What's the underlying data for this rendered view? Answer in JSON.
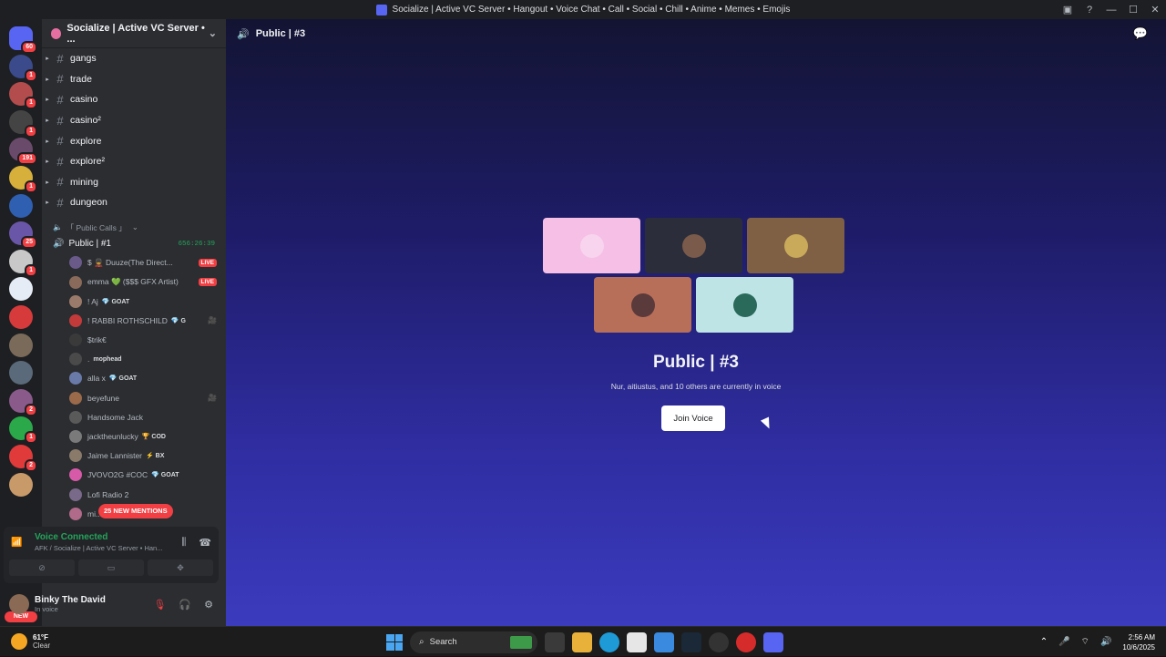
{
  "window": {
    "title": "Socialize | Active VC Server • Hangout • Voice Chat • Call • Social • Chill • Anime • Memes • Emojis"
  },
  "servers": [
    {
      "name": "discord-home",
      "color": "#5865f2",
      "badge": "60"
    },
    {
      "color": "#3a4a8a",
      "badge": "1"
    },
    {
      "color": "#b34d4d",
      "badge": "1"
    },
    {
      "color": "#444",
      "badge": "1"
    },
    {
      "color": "#6a4a6a",
      "badge": "191"
    },
    {
      "color": "#d6b03a",
      "badge": "1"
    },
    {
      "color": "#2f5fb0",
      "badge": ""
    },
    {
      "color": "#6a56a8",
      "badge": "25"
    },
    {
      "color": "#c8c8c8",
      "badge": "1"
    },
    {
      "color": "#e6ecf5",
      "badge": ""
    },
    {
      "color": "#d63a3a",
      "badge": ""
    },
    {
      "color": "#7a6a5a",
      "badge": ""
    },
    {
      "color": "#5a6a7a",
      "badge": ""
    },
    {
      "color": "#8a5a8a",
      "badge": "2"
    },
    {
      "color": "#2aa84a",
      "badge": "1"
    },
    {
      "color": "#e03a3a",
      "badge": "2"
    },
    {
      "color": "#c89a6a",
      "badge": ""
    }
  ],
  "new_pill": "NEW",
  "guild": {
    "name": "Socialize | Active VC Server • ..."
  },
  "channels": [
    {
      "name": "gangs"
    },
    {
      "name": "trade"
    },
    {
      "name": "casino"
    },
    {
      "name": "casino²"
    },
    {
      "name": "explore"
    },
    {
      "name": "explore²"
    },
    {
      "name": "mining"
    },
    {
      "name": "dungeon"
    }
  ],
  "category": "「 Public Calls 」",
  "voice_channel": {
    "name": "Public | #1",
    "timer": "656:26:39"
  },
  "members": [
    {
      "name": "$ 💂 Duuze(The Direct...",
      "tag": "",
      "live": "LIVE",
      "av": "#6a5a8a",
      "icon": ""
    },
    {
      "name": "emma 💚 ($$$ GFX Artist)",
      "tag": "",
      "live": "LIVE",
      "av": "#8a6a5a",
      "icon": ""
    },
    {
      "name": "! Aj",
      "tag": "💎 GOAT",
      "live": "",
      "av": "#9a7a6a",
      "icon": ""
    },
    {
      "name": "! RABBI ROTHSCHILD",
      "tag": "💎 G",
      "live": "",
      "av": "#c23a3a",
      "icon": "🎥"
    },
    {
      "name": "$trik€",
      "tag": "",
      "live": "",
      "av": "#3a3a3a",
      "icon": ""
    },
    {
      "name": ".",
      "tag": "mophead",
      "live": "",
      "av": "#4a4a4a",
      "icon": ""
    },
    {
      "name": "alla x",
      "tag": "💎 GOAT",
      "live": "",
      "av": "#6a7aa8",
      "icon": ""
    },
    {
      "name": "beyefune",
      "tag": "",
      "live": "",
      "av": "#9a6a4a",
      "icon": "🎥"
    },
    {
      "name": "Handsome Jack",
      "tag": "",
      "live": "",
      "av": "#5a5a5a",
      "icon": ""
    },
    {
      "name": "jacktheunlucky",
      "tag": "🏆 COD",
      "live": "",
      "av": "#7a7a7a",
      "icon": ""
    },
    {
      "name": "Jaime Lannister",
      "tag": "⚡ BX",
      "live": "",
      "av": "#8a7a6a",
      "icon": ""
    },
    {
      "name": "JVOVO2G #COC",
      "tag": "💎 GOAT",
      "live": "",
      "av": "#d65aa8",
      "icon": ""
    },
    {
      "name": "Lofi Radio 2",
      "tag": "",
      "live": "",
      "av": "#7a6a8a",
      "icon": ""
    },
    {
      "name": "mi...",
      "tag": "",
      "live": "",
      "av": "#b06a8a",
      "icon": ""
    }
  ],
  "mentions_pill": "25 NEW MENTIONS",
  "voice_status": {
    "title": "Voice Connected",
    "subtitle": "AFK / Socialize | Active VC Server • Han..."
  },
  "user": {
    "name": "Binky The David",
    "status": "In voice"
  },
  "main": {
    "header_title": "Public | #3",
    "stage_title": "Public | #3",
    "stage_subtitle": "Nur, aitiustus, and 10 others are currently in voice",
    "join_label": "Join Voice",
    "tiles": [
      {
        "bg": "#f6bfe6",
        "av": "#f8d4ee"
      },
      {
        "bg": "#2b2d3a",
        "av": "#7a5a4a"
      },
      {
        "bg": "#7f6045",
        "av": "#c8aa5a"
      },
      {
        "bg": "#b86f5a",
        "av": "#5a3a3a"
      },
      {
        "bg": "#bfe4e6",
        "av": "#2a6a5a"
      }
    ]
  },
  "taskbar": {
    "temp": "61°F",
    "condition": "Clear",
    "search_placeholder": "Search",
    "time": "2:56 AM",
    "date": "10/6/2025"
  },
  "colors": {
    "accent": "#5865f2",
    "online": "#23a55a",
    "danger": "#f23f43"
  }
}
